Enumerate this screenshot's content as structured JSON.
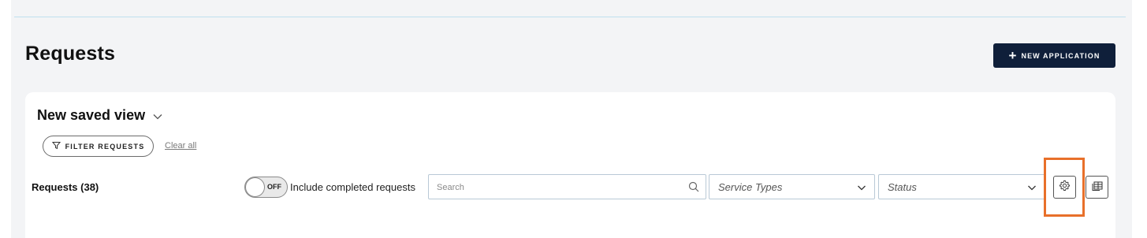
{
  "page": {
    "title": "Requests"
  },
  "header": {
    "new_application_label": "NEW APPLICATION",
    "plus_glyph": "+"
  },
  "view": {
    "title": "New saved view",
    "chevron_glyph": "⌵"
  },
  "filters": {
    "filter_requests_label": "FILTER REQUESTS",
    "clear_all_label": "Clear all"
  },
  "toolbar": {
    "requests_count_label": "Requests (38)",
    "toggle": {
      "state": "OFF",
      "label": "Include completed requests"
    },
    "search": {
      "placeholder": "Search",
      "value": ""
    },
    "service_types": {
      "selected": "Service Types"
    },
    "status": {
      "selected": "Status"
    }
  },
  "icons": {
    "filter": "funnel-icon",
    "search": "search-icon",
    "dropdown": "chevron-down-icon",
    "settings": "gear-icon",
    "export": "export-table-icon"
  },
  "colors": {
    "primary_button": "#0f1f3a",
    "highlight_outline": "#e8702a",
    "input_border": "#b9c9d6",
    "page_background": "#f3f4f6"
  }
}
